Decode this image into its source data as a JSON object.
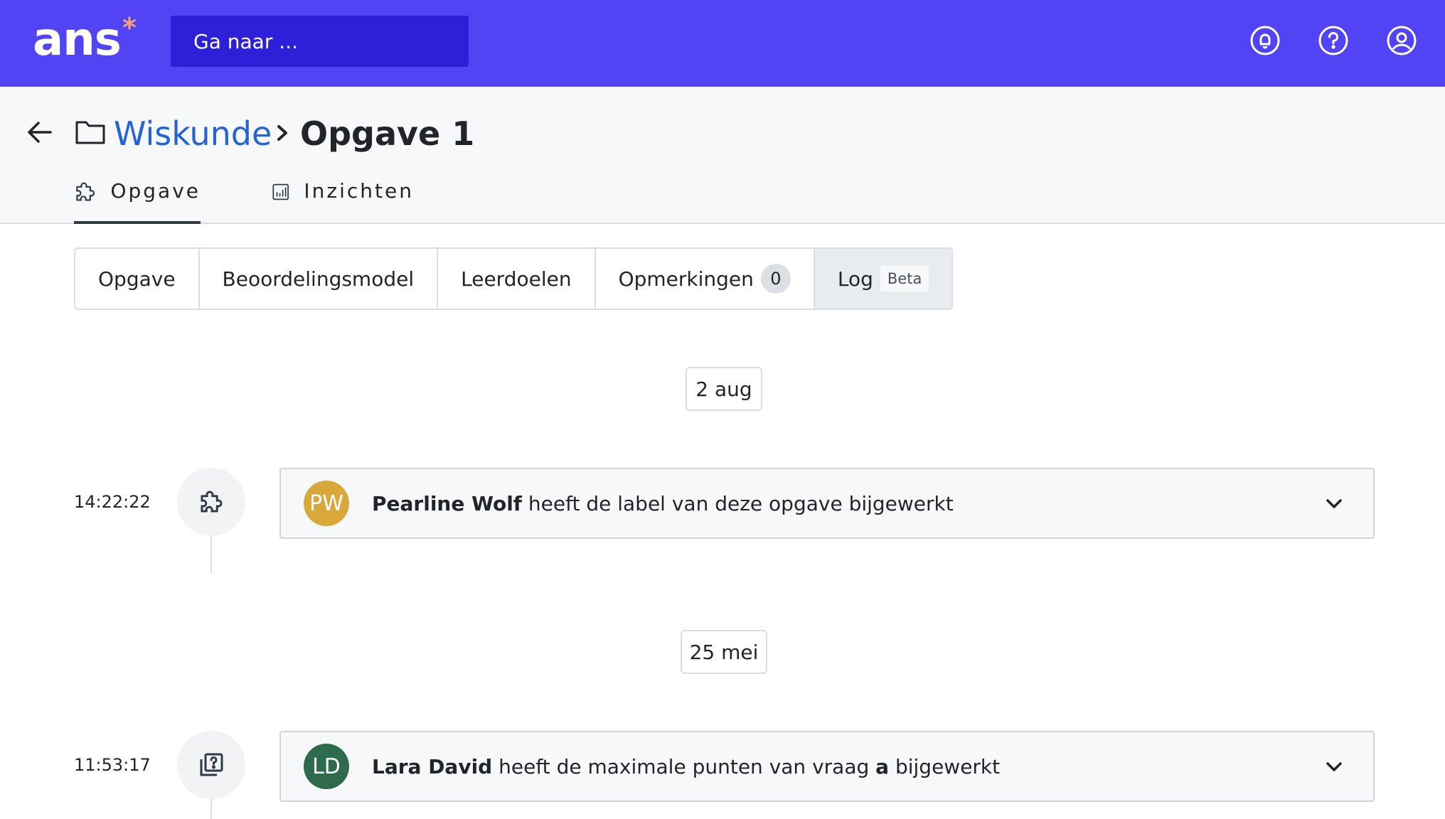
{
  "topbar": {
    "logo_text": "ans",
    "logo_mark": "*",
    "search_placeholder": "Ga naar ...",
    "icons": [
      "notification-bell-icon",
      "help-icon",
      "user-account-icon"
    ],
    "colors": {
      "bar": "#5244f5",
      "search": "#2e20d8",
      "logo_mark": "#f4a27b"
    }
  },
  "breadcrumb": {
    "folder": "Wiskunde",
    "separator": ">",
    "current": "Opgave 1"
  },
  "main_tabs": [
    {
      "label": "Opgave",
      "icon": "puzzle-icon",
      "active": true
    },
    {
      "label": "Inzichten",
      "icon": "bar-chart-icon",
      "active": false
    }
  ],
  "sub_tabs": [
    {
      "label": "Opgave"
    },
    {
      "label": "Beoordelingsmodel"
    },
    {
      "label": "Leerdoelen"
    },
    {
      "label": "Opmerkingen",
      "count": "0"
    },
    {
      "label": "Log",
      "badge": "Beta",
      "active": true
    }
  ],
  "log": [
    {
      "date": "2 aug",
      "time": "14:22:22",
      "icon": "puzzle-icon",
      "initials": "PW",
      "avatar_color": "#d8a93a",
      "user": "Pearline Wolf",
      "action": " heeft de label van deze opgave bijgewerkt"
    },
    {
      "date": "25 mei",
      "time": "11:53:17",
      "icon": "question-stack-icon",
      "initials": "LD",
      "avatar_color": "#2e6b4c",
      "user": "Lara David",
      "action_pre": " heeft de maximale punten van vraag ",
      "action_bold": "a",
      "action_post": " bijgewerkt"
    }
  ]
}
